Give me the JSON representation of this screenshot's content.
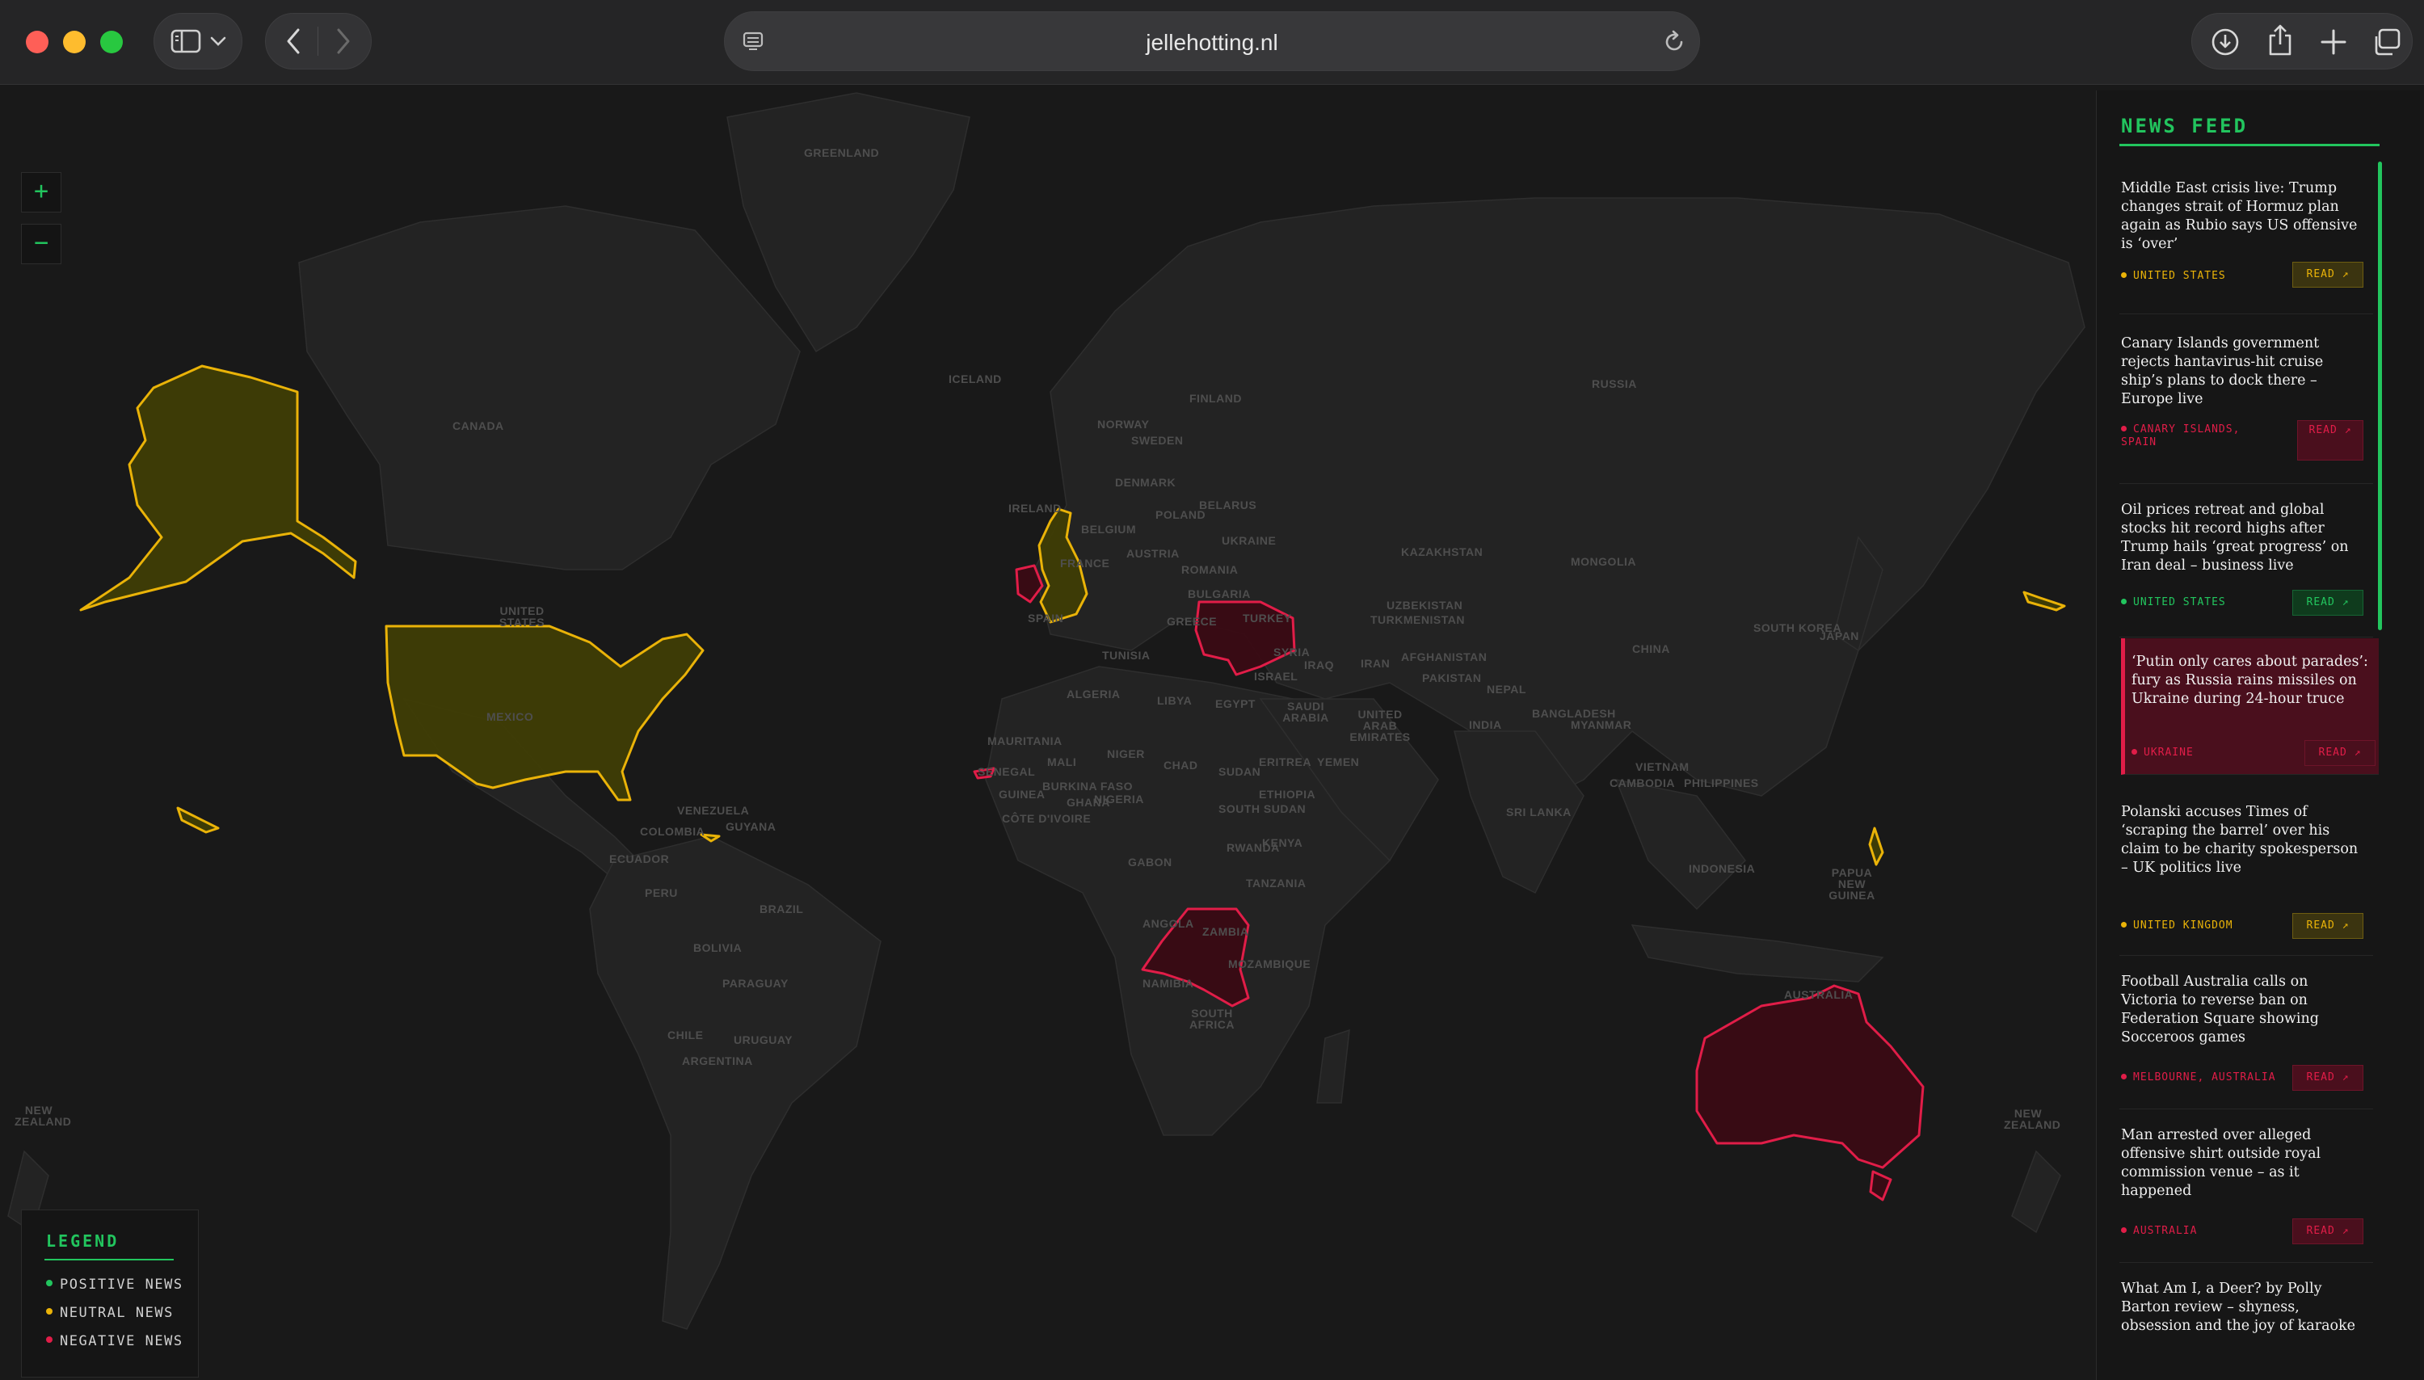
{
  "browser": {
    "url": "jellehotting.nl",
    "icons": [
      "sidebar-icon",
      "chevron-down-icon",
      "back-icon",
      "forward-icon",
      "page-menu-icon",
      "reload-icon",
      "download-icon",
      "share-icon",
      "new-tab-icon",
      "tabs-overview-icon"
    ]
  },
  "map": {
    "zoom_in": "+",
    "zoom_out": "−",
    "labels": {
      "greenland": "GREENLAND",
      "iceland": "ICELAND",
      "canada": "CANADA",
      "united_states": "UNITED STATES",
      "mexico": "MEXICO",
      "venezuela": "VENEZUELA",
      "colombia": "COLOMBIA",
      "guyana": "GUYANA",
      "ecuador": "ECUADOR",
      "peru": "PERU",
      "brazil": "BRAZIL",
      "bolivia": "BOLIVIA",
      "paraguay": "PARAGUAY",
      "chile": "CHILE",
      "argentina": "ARGENTINA",
      "uruguay": "URUGUAY",
      "norway": "NORWAY",
      "sweden": "SWEDEN",
      "finland": "FINLAND",
      "russia": "RUSSIA",
      "belarus": "BELARUS",
      "ukraine": "UKRAINE",
      "poland": "POLAND",
      "denmark": "DENMARK",
      "ireland": "IRELAND",
      "belgium": "BELGIUM",
      "france": "FRANCE",
      "austria": "AUSTRIA",
      "romania": "ROMANIA",
      "bulgaria": "BULGARIA",
      "spain": "SPAIN",
      "greece": "GREECE",
      "turkey": "TURKEY",
      "kazakhstan": "KAZAKHSTAN",
      "uzbekistan": "UZBEKISTAN",
      "turkmenistan": "TURKMENISTAN",
      "mongolia": "MONGOLIA",
      "china": "CHINA",
      "south_korea": "SOUTH KOREA",
      "japan": "JAPAN",
      "syria": "SYRIA",
      "iraq": "IRAQ",
      "iran": "IRAN",
      "afghanistan": "AFGHANISTAN",
      "pakistan": "PAKISTAN",
      "israel": "ISRAEL",
      "egypt": "EGYPT",
      "libya": "LIBYA",
      "algeria": "ALGERIA",
      "tunisia": "TUNISIA",
      "saudi_arabia": "SAUDI ARABIA",
      "uae": "UNITED ARAB EMIRATES",
      "nepal": "NEPAL",
      "bangladesh": "BANGLADESH",
      "india": "INDIA",
      "myanmar": "MYANMAR",
      "vietnam": "VIETNAM",
      "cambodia": "CAMBODIA",
      "philippines": "PHILIPPINES",
      "sri_lanka": "SRI LANKA",
      "indonesia": "INDONESIA",
      "papua_new_guinea": "PAPUA NEW GUINEA",
      "mauritania": "MAURITANIA",
      "mali": "MALI",
      "niger": "NIGER",
      "chad": "CHAD",
      "sudan": "SUDAN",
      "eritrea": "ERITREA",
      "yemen": "YEMEN",
      "ethiopia": "ETHIOPIA",
      "senegal": "SENEGAL",
      "guinea": "GUINEA",
      "burkina_faso": "BURKINA FASO",
      "ghana": "GHANA",
      "nigeria": "NIGERIA",
      "cote_divoire": "CÔTE D'IVOIRE",
      "south_sudan": "SOUTH SUDAN",
      "kenya": "KENYA",
      "gabon": "GABON",
      "rwanda": "RWANDA",
      "tanzania": "TANZANIA",
      "angola": "ANGOLA",
      "zambia": "ZAMBIA",
      "mozambique": "MOZAMBIQUE",
      "namibia": "NAMIBIA",
      "south_africa": "SOUTH AFRICA",
      "australia": "AUSTRALIA",
      "new_zealand": "NEW ZEALAND"
    }
  },
  "legend": {
    "title": "LEGEND",
    "items": [
      {
        "label": "POSITIVE NEWS",
        "color": "#22c55e"
      },
      {
        "label": "NEUTRAL NEWS",
        "color": "#eab308"
      },
      {
        "label": "NEGATIVE NEWS",
        "color": "#e11d48"
      }
    ]
  },
  "colors": {
    "accent": "#22c55e",
    "neutral": "#eab308",
    "negative": "#e11d48"
  },
  "news": {
    "title": "NEWS FEED",
    "items": [
      {
        "headline": "Middle East crisis live: Trump changes strait of Hormuz plan again as Rubio says US offensive is ‘over’",
        "location": "UNITED STATES",
        "sentiment": "neutral",
        "read": "READ ↗"
      },
      {
        "headline": "Canary Islands government rejects hantavirus-hit cruise ship’s plans to dock there – Europe live",
        "location": "CANARY ISLANDS, SPAIN",
        "sentiment": "negative",
        "read": "READ ↗"
      },
      {
        "headline": "Oil prices retreat and global stocks hit record highs after Trump hails ‘great progress’ on Iran deal – business live",
        "location": "UNITED STATES",
        "sentiment": "positive",
        "read": "READ ↗"
      },
      {
        "headline": "‘Putin only cares about parades’: fury as Russia rains missiles on Ukraine during 24-hour truce",
        "location": "UKRAINE",
        "sentiment": "negative",
        "read": "READ ↗"
      },
      {
        "headline": "Polanski accuses Times of ‘scraping the barrel’ over his claim to be charity spokesperson – UK politics live",
        "location": "UNITED KINGDOM",
        "sentiment": "neutral",
        "read": "READ ↗"
      },
      {
        "headline": "Football Australia calls on Victoria to reverse ban on Federation Square showing Socceroos games",
        "location": "MELBOURNE, AUSTRALIA",
        "sentiment": "negative",
        "read": "READ ↗"
      },
      {
        "headline": "Man arrested over alleged offensive shirt outside royal commission venue – as it happened",
        "location": "AUSTRALIA",
        "sentiment": "negative",
        "read": "READ ↗"
      },
      {
        "headline": "What Am I, a Deer? by Polly Barton review – shyness, obsession and the joy of karaoke",
        "location": "",
        "sentiment": "",
        "read": ""
      }
    ]
  }
}
